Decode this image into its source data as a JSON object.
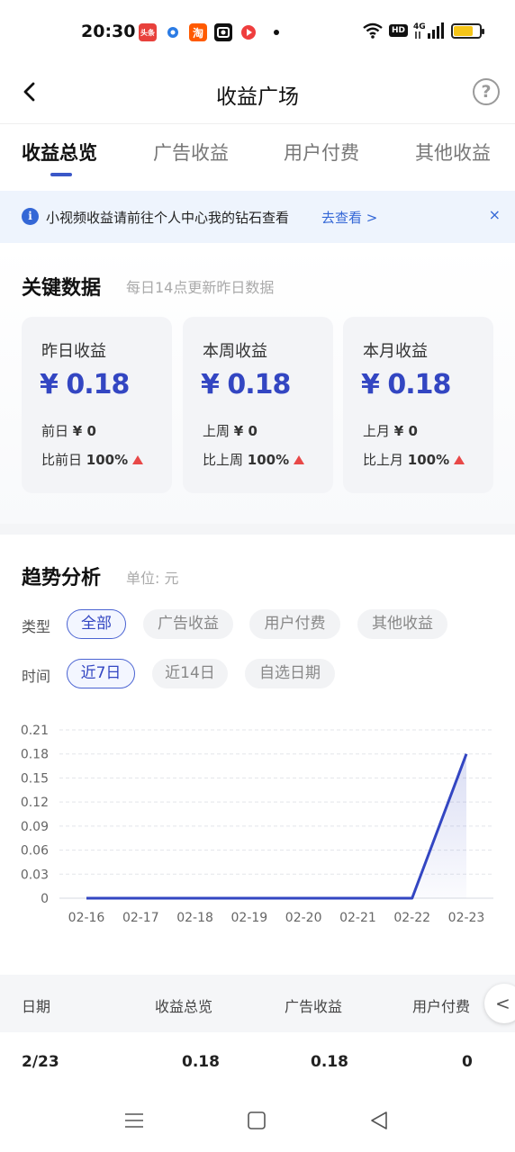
{
  "status_bar": {
    "time": "20:30",
    "apps": [
      {
        "icon": "toutiao-app-icon",
        "text": "头条",
        "color": "#e8413c"
      },
      {
        "icon": "blue-dot-app-icon",
        "text": "",
        "color": "#2b7be4"
      },
      {
        "icon": "taobao-app-icon",
        "text": "淘",
        "color": "#ff5a00"
      },
      {
        "icon": "camera-app-icon",
        "text": "",
        "color": "#111111"
      },
      {
        "icon": "red-app-icon",
        "text": "",
        "color": "#ef3e3e"
      }
    ],
    "network_badge": "HD",
    "signal_label": "4G",
    "battery_level": 0.75
  },
  "header": {
    "title": "收益广场",
    "help_symbol": "?"
  },
  "tabs": [
    {
      "label": "收益总览",
      "active": true
    },
    {
      "label": "广告收益",
      "active": false
    },
    {
      "label": "用户付费",
      "active": false
    },
    {
      "label": "其他收益",
      "active": false
    }
  ],
  "notice": {
    "text": "小视频收益请前往个人中心我的钻石查看",
    "link": "去查看 >",
    "close": "×"
  },
  "key_data": {
    "title": "关键数据",
    "subtitle": "每日14点更新昨日数据",
    "cards": [
      {
        "label": "昨日收益",
        "value": "¥ 0.18",
        "prev_label": "前日",
        "prev_value": "¥ 0",
        "cmp_label": "比前日",
        "cmp_value": "100%"
      },
      {
        "label": "本周收益",
        "value": "¥ 0.18",
        "prev_label": "上周",
        "prev_value": "¥ 0",
        "cmp_label": "比上周",
        "cmp_value": "100%"
      },
      {
        "label": "本月收益",
        "value": "¥ 0.18",
        "prev_label": "上月",
        "prev_value": "¥ 0",
        "cmp_label": "比上月",
        "cmp_value": "100%"
      }
    ]
  },
  "trend": {
    "title": "趋势分析",
    "unit": "单位: 元",
    "type_label": "类型",
    "type_chips": [
      {
        "label": "全部",
        "active": true
      },
      {
        "label": "广告收益",
        "active": false
      },
      {
        "label": "用户付费",
        "active": false
      },
      {
        "label": "其他收益",
        "active": false
      }
    ],
    "time_label": "时间",
    "time_chips": [
      {
        "label": "近7日",
        "active": true
      },
      {
        "label": "近14日",
        "active": false
      },
      {
        "label": "自选日期",
        "active": false
      }
    ]
  },
  "chart_data": {
    "type": "line",
    "x": [
      "02-16",
      "02-17",
      "02-18",
      "02-19",
      "02-20",
      "02-21",
      "02-22",
      "02-23"
    ],
    "series": [
      {
        "values": [
          0,
          0,
          0,
          0,
          0,
          0,
          0,
          0.18
        ]
      }
    ],
    "y_ticks": [
      "0.21",
      "0.18",
      "0.15",
      "0.12",
      "0.09",
      "0.06",
      "0.03",
      "0"
    ],
    "ylim": [
      0,
      0.21
    ],
    "grid": true,
    "line_color": "#3346c2"
  },
  "table": {
    "headers": [
      "日期",
      "收益总览",
      "广告收益",
      "用户付费"
    ],
    "rows": [
      [
        "2/23",
        "0.18",
        "0.18",
        "0"
      ]
    ],
    "collapse_symbol": "<"
  },
  "colors": {
    "accent": "#3346c2",
    "link": "#3467d6",
    "up": "#e84848"
  }
}
